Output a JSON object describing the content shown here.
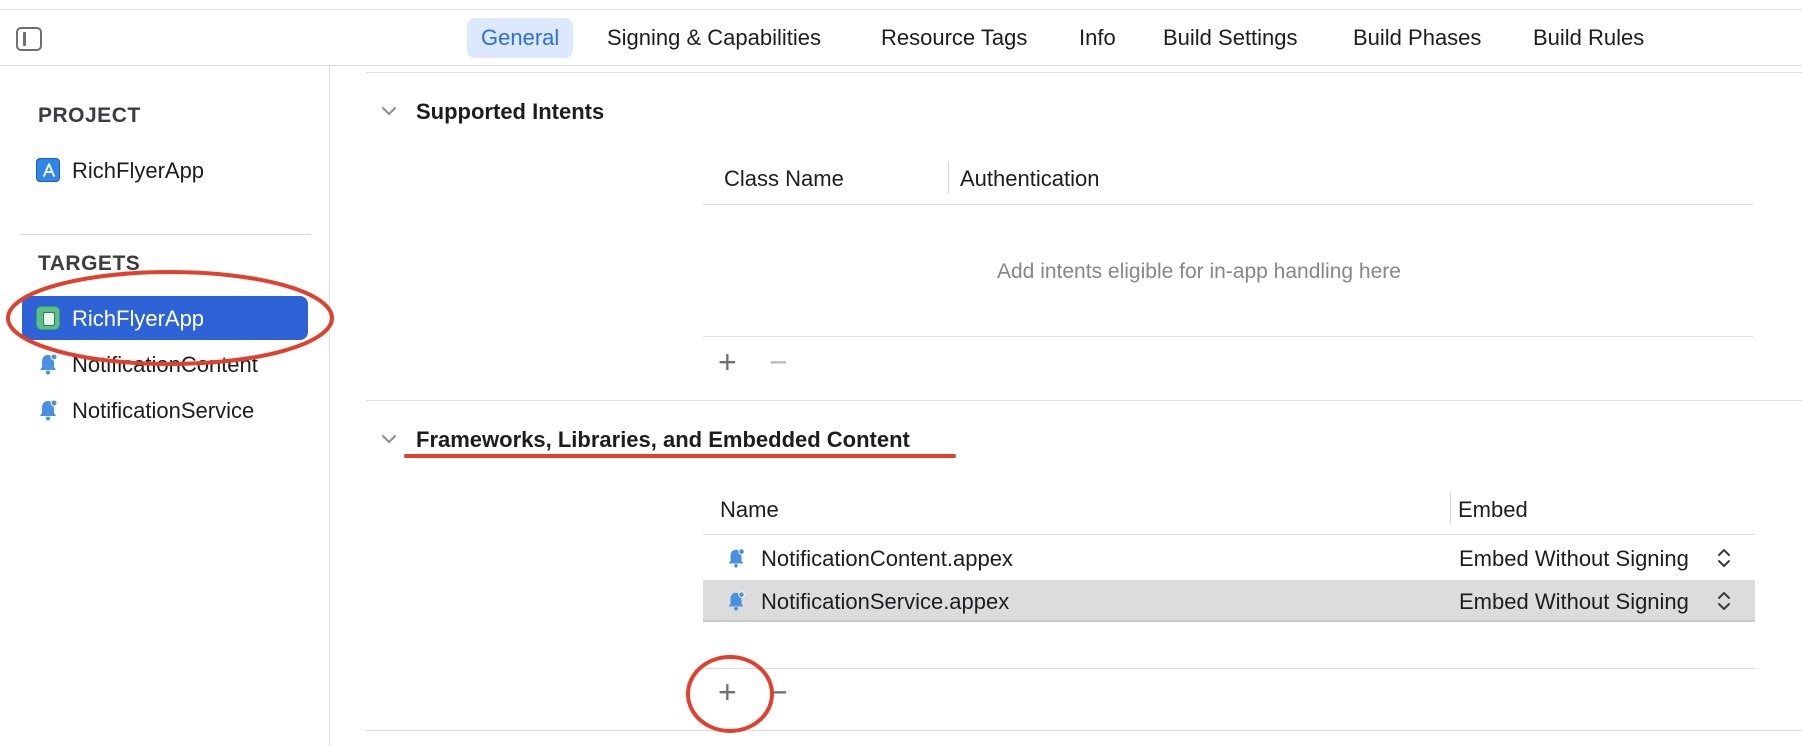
{
  "tabbar": {
    "tabs": [
      {
        "label": "General",
        "active": true
      },
      {
        "label": "Signing & Capabilities",
        "active": false
      },
      {
        "label": "Resource Tags",
        "active": false
      },
      {
        "label": "Info",
        "active": false
      },
      {
        "label": "Build Settings",
        "active": false
      },
      {
        "label": "Build Phases",
        "active": false
      },
      {
        "label": "Build Rules",
        "active": false
      }
    ]
  },
  "sidebar": {
    "project_header": "PROJECT",
    "project_item": "RichFlyerApp",
    "targets_header": "TARGETS",
    "targets": [
      {
        "label": "RichFlyerApp",
        "selected": true,
        "icon": "app-target-icon"
      },
      {
        "label": "NotificationContent",
        "selected": false,
        "icon": "bell-icon"
      },
      {
        "label": "NotificationService",
        "selected": false,
        "icon": "bell-icon"
      }
    ]
  },
  "intents": {
    "title": "Supported Intents",
    "columns": [
      "Class Name",
      "Authentication"
    ],
    "empty_text": "Add intents eligible for in-app handling here",
    "add": "+",
    "remove": "−"
  },
  "frameworks": {
    "title": "Frameworks, Libraries, and Embedded Content",
    "columns": [
      "Name",
      "Embed"
    ],
    "rows": [
      {
        "name": "NotificationContent.appex",
        "embed": "Embed Without Signing",
        "selected": false
      },
      {
        "name": "NotificationService.appex",
        "embed": "Embed Without Signing",
        "selected": true
      }
    ],
    "add": "+",
    "remove": "−"
  },
  "colors": {
    "accent": "#2d63d6",
    "active_tab_bg": "#dce8fb",
    "annotation_red": "#e0402c",
    "bell_blue": "#4a90e2"
  }
}
